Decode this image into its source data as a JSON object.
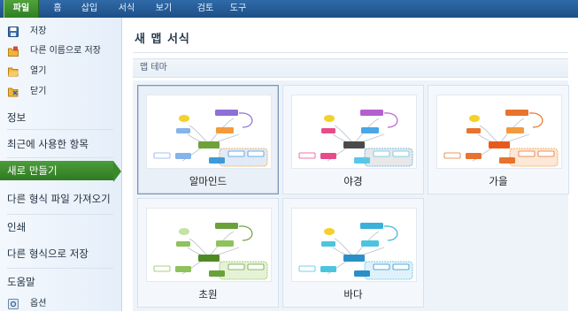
{
  "ribbon": {
    "tabs": [
      {
        "label": "파일",
        "active": true
      },
      {
        "label": "홈"
      },
      {
        "label": "삽입"
      },
      {
        "label": "서식"
      },
      {
        "label": "보기"
      },
      {
        "label": "검토"
      },
      {
        "label": "도구"
      }
    ]
  },
  "sidebar": {
    "items": [
      {
        "label": "저장",
        "icon": "save-icon"
      },
      {
        "label": "다른 이름으로 저장",
        "icon": "save-as-icon"
      },
      {
        "label": "열기",
        "icon": "open-folder-icon"
      },
      {
        "label": "닫기",
        "icon": "close-folder-icon"
      },
      {
        "label": "정보"
      },
      {
        "label": "최근에 사용한 항목"
      },
      {
        "label": "새로 만들기",
        "selected": true
      },
      {
        "label": "다른 형식 파일 가져오기"
      },
      {
        "label": "인쇄"
      },
      {
        "label": "다른 형식으로 저장"
      },
      {
        "label": "도움말"
      },
      {
        "label": "옵션",
        "icon": "options-icon"
      }
    ]
  },
  "main": {
    "title": "새 맵 서식",
    "section": "맵 테마",
    "themes": [
      {
        "name": "알마인드",
        "selected": true,
        "palette": [
          "#f4d12b",
          "#8e6fd8",
          "#86b3ea",
          "#f39a3d",
          "#6ea13a",
          "#e2eaf6",
          "#3f9ad9"
        ]
      },
      {
        "name": "야경",
        "palette": [
          "#f4d12b",
          "#b45fd0",
          "#e84b8a",
          "#4aa6e8",
          "#4a4a4a",
          "#e8e8e8",
          "#59c7e8"
        ]
      },
      {
        "name": "가을",
        "palette": [
          "#f4d12b",
          "#e7732d",
          "#e7732d",
          "#f39a3d",
          "#e85a1b",
          "#fde7d6",
          "#e7732d"
        ]
      },
      {
        "name": "초원",
        "palette": [
          "#c6e2a6",
          "#6aa13a",
          "#8ec25b",
          "#8ec25b",
          "#4f8a24",
          "#e6f2d6",
          "#6aa13a"
        ]
      },
      {
        "name": "바다",
        "palette": [
          "#f4d12b",
          "#3bb0d8",
          "#4cc4e0",
          "#4cc4e0",
          "#2c8fc8",
          "#dff2fb",
          "#2c8fc8"
        ]
      }
    ]
  }
}
